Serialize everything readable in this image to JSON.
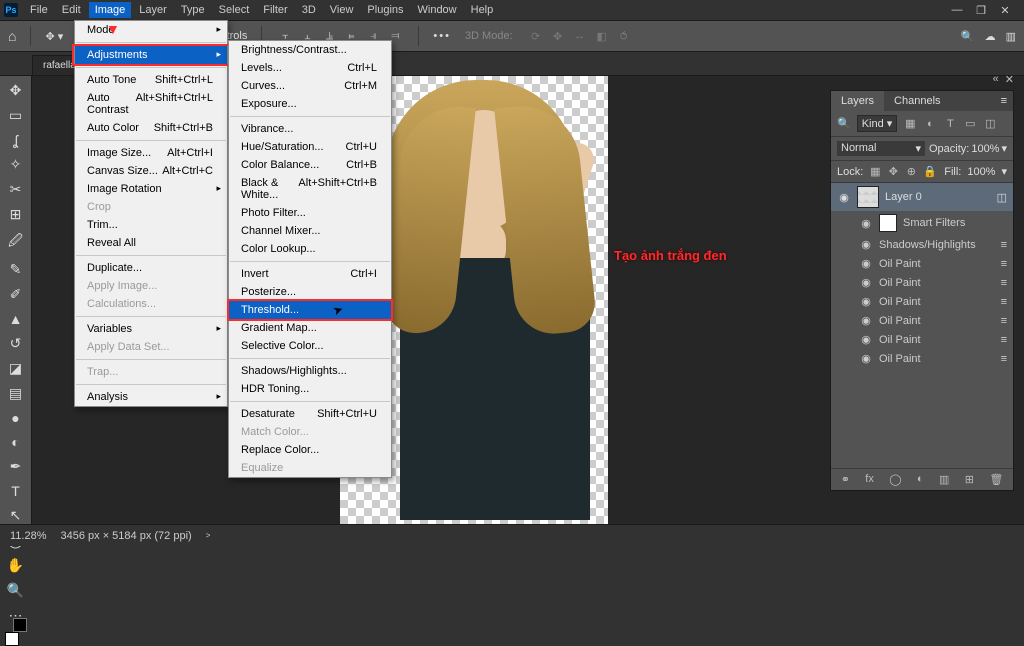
{
  "menu": {
    "file": "File",
    "edit": "Edit",
    "image": "Image",
    "layer": "Layer",
    "type": "Type",
    "select": "Select",
    "filter": "Filter",
    "threeD": "3D",
    "view": "View",
    "plugins": "Plugins",
    "window": "Window",
    "help": "Help"
  },
  "options": {
    "transform": "Show Transform Controls",
    "threeDMode": "3D Mode:"
  },
  "tab": "rafaella",
  "imageMenu": {
    "mode": "Mode",
    "adjustments": "Adjustments",
    "autoTone": "Auto Tone",
    "autoToneK": "Shift+Ctrl+L",
    "autoContrast": "Auto Contrast",
    "autoContrastK": "Alt+Shift+Ctrl+L",
    "autoColor": "Auto Color",
    "autoColorK": "Shift+Ctrl+B",
    "imageSize": "Image Size...",
    "imageSizeK": "Alt+Ctrl+I",
    "canvasSize": "Canvas Size...",
    "canvasSizeK": "Alt+Ctrl+C",
    "imageRotation": "Image Rotation",
    "crop": "Crop",
    "trim": "Trim...",
    "revealAll": "Reveal All",
    "duplicate": "Duplicate...",
    "applyImage": "Apply Image...",
    "calculations": "Calculations...",
    "variables": "Variables",
    "applyDataSet": "Apply Data Set...",
    "trap": "Trap...",
    "analysis": "Analysis"
  },
  "adjMenu": {
    "brightness": "Brightness/Contrast...",
    "levels": "Levels...",
    "levelsK": "Ctrl+L",
    "curves": "Curves...",
    "curvesK": "Ctrl+M",
    "exposure": "Exposure...",
    "vibrance": "Vibrance...",
    "hue": "Hue/Saturation...",
    "hueK": "Ctrl+U",
    "colorBalance": "Color Balance...",
    "colorBalanceK": "Ctrl+B",
    "blackWhite": "Black & White...",
    "blackWhiteK": "Alt+Shift+Ctrl+B",
    "photoFilter": "Photo Filter...",
    "channelMixer": "Channel Mixer...",
    "colorLookup": "Color Lookup...",
    "invert": "Invert",
    "invertK": "Ctrl+I",
    "posterize": "Posterize...",
    "threshold": "Threshold...",
    "gradientMap": "Gradient Map...",
    "selectiveColor": "Selective Color...",
    "shadows": "Shadows/Highlights...",
    "hdr": "HDR Toning...",
    "desaturate": "Desaturate",
    "desaturateK": "Shift+Ctrl+U",
    "matchColor": "Match Color...",
    "replaceColor": "Replace Color...",
    "equalize": "Equalize"
  },
  "annotation": "Tạo ảnh trắng đen",
  "layersPanel": {
    "tabLayers": "Layers",
    "tabChannels": "Channels",
    "kind": "Kind",
    "blend": "Normal",
    "opacityLbl": "Opacity:",
    "opacity": "100%",
    "lockLbl": "Lock:",
    "fillLbl": "Fill:",
    "fill": "100%",
    "layer0": "Layer 0",
    "smartFilters": "Smart Filters",
    "shadowsHL": "Shadows/Highlights",
    "oilPaint": "Oil Paint"
  },
  "status": {
    "zoom": "11.28%",
    "dims": "3456 px × 5184 px (72 ppi)",
    "caret": ">"
  }
}
